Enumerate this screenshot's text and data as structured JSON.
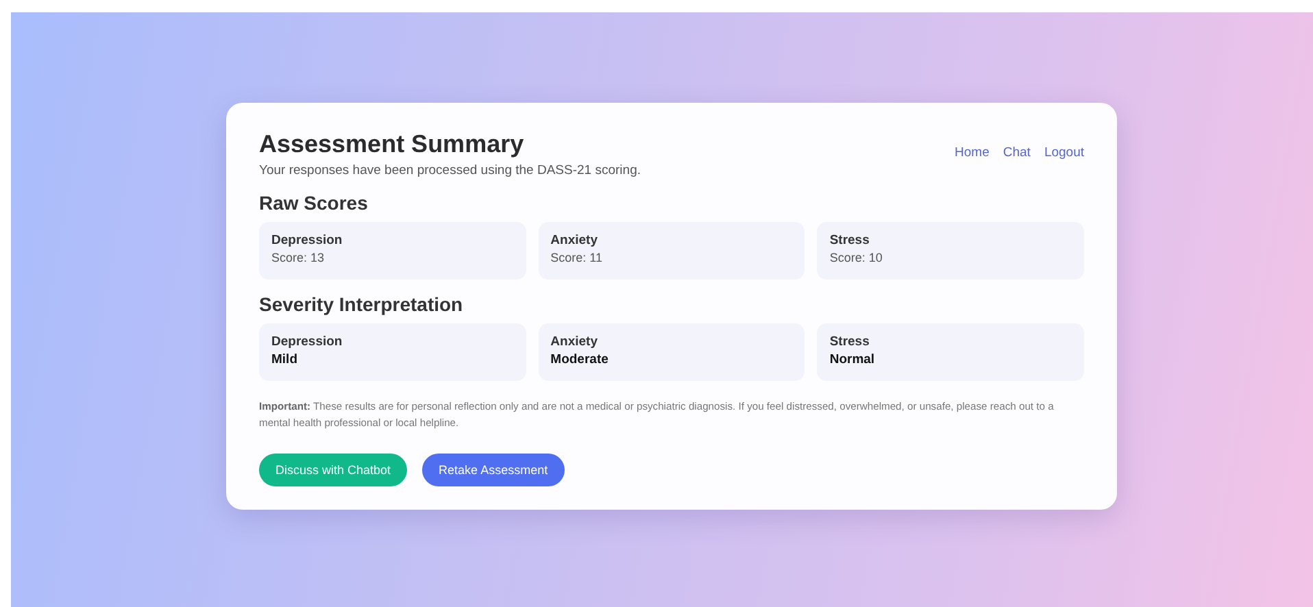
{
  "header": {
    "title": "Assessment Summary",
    "subtitle": "Your responses have been processed using the DASS-21 scoring."
  },
  "nav": [
    "Home",
    "Chat",
    "Logout"
  ],
  "raw_scores": {
    "heading": "Raw Scores",
    "items": [
      {
        "label": "Depression",
        "value": "Score: 13"
      },
      {
        "label": "Anxiety",
        "value": "Score: 11"
      },
      {
        "label": "Stress",
        "value": "Score: 10"
      }
    ]
  },
  "severity": {
    "heading": "Severity Interpretation",
    "items": [
      {
        "label": "Depression",
        "value": "Mild"
      },
      {
        "label": "Anxiety",
        "value": "Moderate"
      },
      {
        "label": "Stress",
        "value": "Normal"
      }
    ]
  },
  "notice": "**Important:** These results are for personal reflection only and are not a medical or psychiatric diagnosis. If you feel distressed, overwhelmed, or unsafe, please reach out to a mental health professional or local helpline.",
  "buttons": [
    {
      "label": "Discuss with Chatbot",
      "kind": "secondary"
    },
    {
      "label": "Retake Assessment",
      "kind": "primary"
    }
  ]
}
